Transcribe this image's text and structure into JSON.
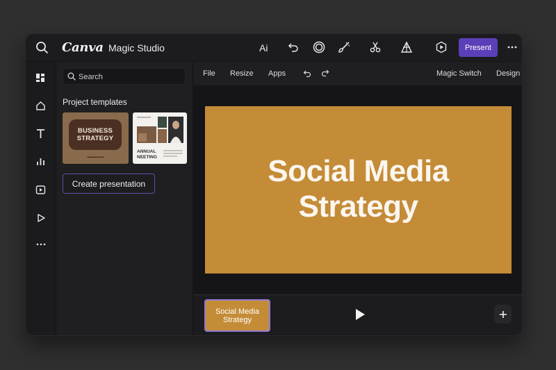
{
  "app": {
    "logo": "Canva",
    "studio_title": "Magic Studio",
    "ai_label": "Ai",
    "present_label": "Present"
  },
  "toolbar_icons": [
    "search-icon",
    "undo-icon",
    "circle-icon",
    "brush-icon",
    "scissors-icon",
    "pen-nib-icon",
    "play-hexagon-icon",
    "more-icon"
  ],
  "rail_icons": [
    "templates-icon",
    "elements-icon",
    "text-icon",
    "chart-icon",
    "video-icon",
    "play-icon",
    "more-icon"
  ],
  "panel": {
    "search_placeholder": "Search",
    "section_title": "Project templates",
    "templates": [
      {
        "title_line1": "BUSINESS",
        "title_line2": "STRATEGY"
      },
      {
        "title_line1": "ANNUAL",
        "title_line2": "NEETING"
      }
    ],
    "create_button": "Create presentation"
  },
  "menu": {
    "file": "File",
    "resize": "Resize",
    "apps": "Apps",
    "magic_switch": "Magic Switch",
    "design": "Design"
  },
  "slide": {
    "title_line1": "Social Media",
    "title_line2": "Strategy",
    "background": "#c48c37"
  },
  "thumbnail": {
    "line1": "Social Media",
    "line2": "Strategy"
  },
  "colors": {
    "accent": "#5b3fb8",
    "slide_bg": "#c48c37"
  }
}
